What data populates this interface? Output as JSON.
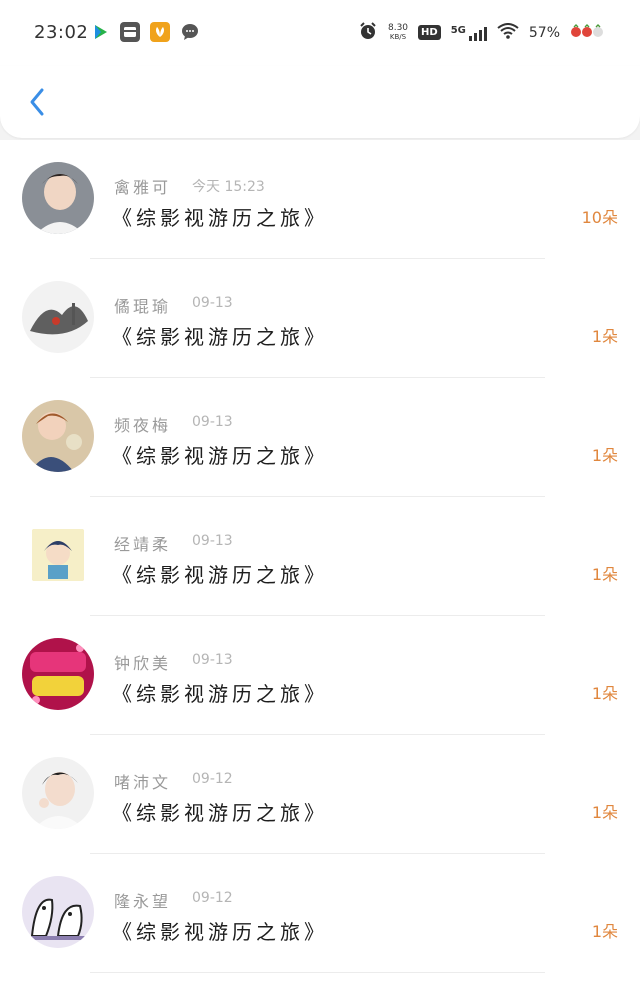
{
  "status_bar": {
    "time": "23:02",
    "speed_value": "8.30",
    "speed_unit": "KB/S",
    "hd": "HD",
    "network": "5G",
    "battery": "57%"
  },
  "header": {
    "back_icon": "chevron-left-icon"
  },
  "list": [
    {
      "name": "禽雅可",
      "date": "今天 15:23",
      "title": "《综影视游历之旅》",
      "count": "10朵"
    },
    {
      "name": "僪琨瑜",
      "date": "09-13",
      "title": "《综影视游历之旅》",
      "count": "1朵"
    },
    {
      "name": "频夜梅",
      "date": "09-13",
      "title": "《综影视游历之旅》",
      "count": "1朵"
    },
    {
      "name": "经靖柔",
      "date": "09-13",
      "title": "《综影视游历之旅》",
      "count": "1朵"
    },
    {
      "name": "钟欣美",
      "date": "09-13",
      "title": "《综影视游历之旅》",
      "count": "1朵"
    },
    {
      "name": "啫沛文",
      "date": "09-12",
      "title": "《综影视游历之旅》",
      "count": "1朵"
    },
    {
      "name": "隆永望",
      "date": "09-12",
      "title": "《综影视游历之旅》",
      "count": "1朵"
    }
  ],
  "colors": {
    "accent_count": "#e0873e",
    "back_icon": "#3a8ee6"
  }
}
